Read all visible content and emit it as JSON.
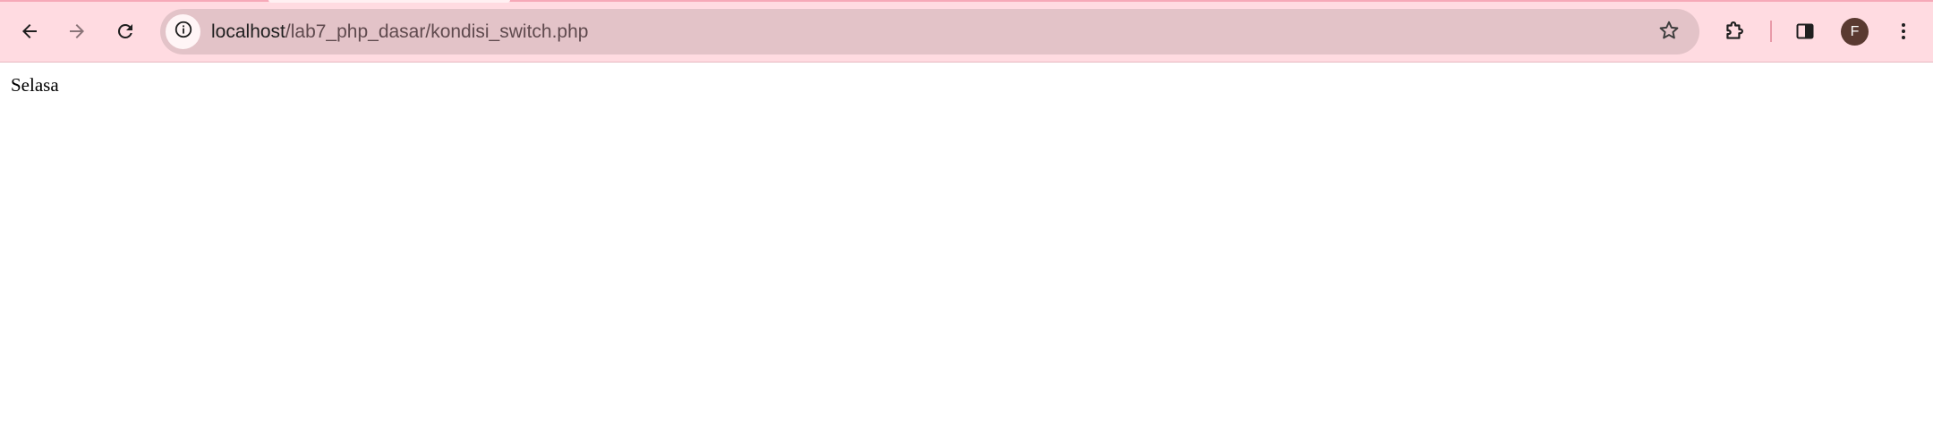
{
  "browser": {
    "url_host": "localhost",
    "url_path": "/lab7_php_dasar/kondisi_switch.php",
    "profile_initial": "F",
    "theme_color": "#ffdbe1",
    "omnibox_color": "#e3c3c8",
    "icons": {
      "back": "arrow-left-icon",
      "forward": "arrow-right-icon",
      "reload": "reload-icon",
      "site_info": "info-icon",
      "bookmark": "star-icon",
      "extensions": "puzzle-icon",
      "side_panel": "side-panel-icon",
      "menu": "kebab-menu-icon"
    }
  },
  "page": {
    "text": "Selasa"
  }
}
